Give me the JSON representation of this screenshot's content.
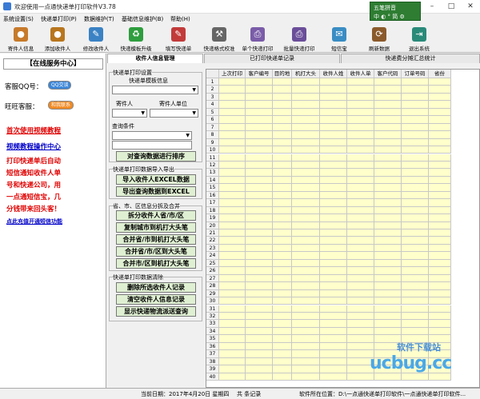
{
  "window": {
    "title": "欢迎使用一点通快递单打印软件V3.78",
    "min": "–",
    "max": "□",
    "close": "✕"
  },
  "ime": {
    "row1": "五笔拼音",
    "row2": "中 ◐ ° 简 ⚙"
  },
  "menu": [
    "系统设置(S)",
    "快递单打印(P)",
    "数据维护(T)",
    "基础信息维护(B)",
    "帮助(H)"
  ],
  "toolbar": [
    {
      "label": "寄件人信息",
      "icon": "person-icon",
      "color": "#c77a2a",
      "glyph": "●"
    },
    {
      "label": "添加收件人",
      "icon": "add-person-icon",
      "color": "#b8761e",
      "glyph": "●"
    },
    {
      "label": "修改收件人",
      "icon": "edit-person-icon",
      "color": "#3a82c4",
      "glyph": "✎"
    },
    {
      "label": "快递模板升级",
      "icon": "recycle-icon",
      "color": "#2e9e3e",
      "glyph": "♻"
    },
    {
      "label": "填写快递单",
      "icon": "form-icon",
      "color": "#c23b3b",
      "glyph": "✎"
    },
    {
      "label": "快递格式校准",
      "icon": "tools-icon",
      "color": "#666666",
      "glyph": "⚒"
    },
    {
      "label": "单个快递打印",
      "icon": "printer-icon",
      "color": "#7a5ca8",
      "glyph": "⎙"
    },
    {
      "label": "批量快递打印",
      "icon": "batch-printer-icon",
      "color": "#6b4e9a",
      "glyph": "⎙"
    },
    {
      "label": "短信宝",
      "icon": "sms-icon",
      "color": "#3a8dc4",
      "glyph": "✉"
    },
    {
      "label": "刷新数据",
      "icon": "brush-icon",
      "color": "#8b5a2b",
      "glyph": "⟳"
    },
    {
      "label": "退出系统",
      "icon": "exit-icon",
      "color": "#2a8a7a",
      "glyph": "⇥"
    }
  ],
  "sidebar": {
    "service_title": "【在线服务中心】",
    "qq_label": "客服QQ号：",
    "qq_badge": "QQ交谈",
    "ww_label": "旺旺客服：",
    "ww_badge": "和我联系",
    "link1": "首次使用视频教程",
    "link2": "视频教程操作中心",
    "promo": [
      "打印快递单后自动",
      "短信通知收件人单",
      "号和快递公司，用",
      "一点通短信宝，几",
      "分钱带来回头客！"
    ],
    "sms_link": "点此充值开通短信功能"
  },
  "tabs": [
    "收件人信息管理",
    "已打印快递单记录",
    "快递费分摊汇总统计"
  ],
  "panel": {
    "g1_title": "快递单打印设置",
    "template_label": "快递单模板信息",
    "sender_label": "寄件人",
    "sender_unit_label": "寄件人单位",
    "query_label": "查询条件",
    "sort_button": "对查询数据进行排序",
    "g2_title": "快递单打印数据导入导出",
    "import_button": "导入收件人EXCEL数据",
    "export_button": "导出查询数据到EXCEL",
    "g3_title": "省、市、区信息分拆及合并",
    "split_button": "拆分收件人省/市/区",
    "copy_button": "复制城市到机打大头笔",
    "merge1_button": "合并省/市到机打大头笔",
    "merge2_button": "合并省/市/区到大头笔",
    "merge3_button": "合并市/区到机打大头笔",
    "g4_title": "快递单打印数据清除",
    "delete_button": "删除所选收件人记录",
    "clear_button": "清空收件人信息记录",
    "show_button": "显示快递物流派送查询"
  },
  "grid": {
    "columns": [
      "上次打印",
      "客户编号",
      "目的地",
      "机打大头",
      "收件人姓",
      "收件人单",
      "客户代码",
      "订单号码",
      "省份"
    ],
    "rows": [
      "1",
      "2",
      "3",
      "4",
      "5",
      "6",
      "7",
      "8",
      "9",
      "10",
      "11",
      "12",
      "13",
      "14",
      "15",
      "16",
      "17",
      "18",
      "19",
      "20",
      "21",
      "22",
      "23",
      "24",
      "25",
      "26",
      "27",
      "28",
      "29",
      "30",
      "31",
      "32",
      "33",
      "34",
      "35",
      "36",
      "37",
      "38",
      "39",
      "40"
    ]
  },
  "status": {
    "date": "当前日期：2017年4月20日 星期四",
    "count": "共    条记录",
    "path": "软件所在位置：D:\\一点通快递单打印软件\\一点通快递单打印软件..."
  },
  "watermark": {
    "small": "软件下载站",
    "big": "ucbug.cc"
  }
}
